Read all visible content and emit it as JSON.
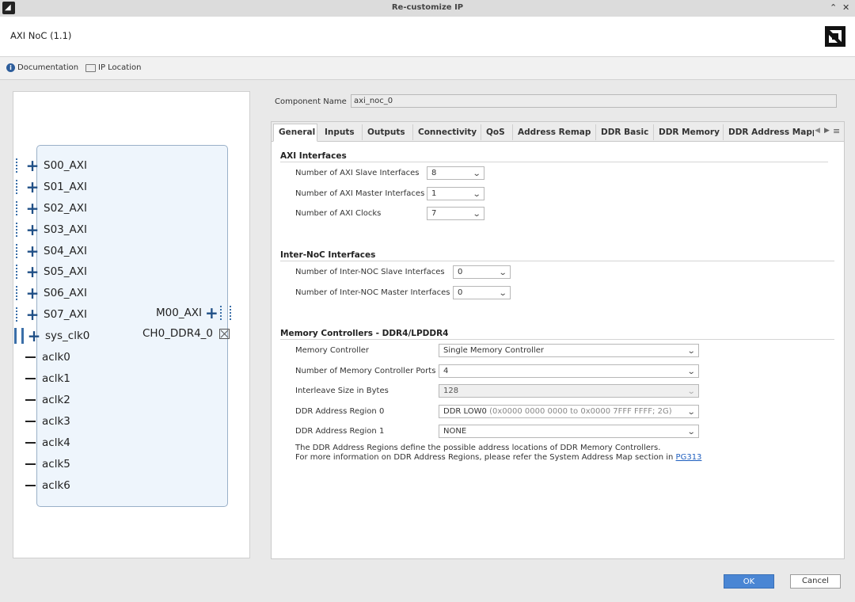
{
  "window": {
    "title": "Re-customize IP",
    "maximize_glyph": "⌃",
    "close_glyph": "✕",
    "app_icon": "amd-app-icon"
  },
  "header": {
    "ip_title": "AXI NoC (1.1)",
    "logo": "amd-logo"
  },
  "links": {
    "documentation": "Documentation",
    "ip_location": "IP Location"
  },
  "diagram": {
    "slave_ports": [
      "S00_AXI",
      "S01_AXI",
      "S02_AXI",
      "S03_AXI",
      "S04_AXI",
      "S05_AXI",
      "S06_AXI",
      "S07_AXI"
    ],
    "sys_clk": "sys_clk0",
    "clocks": [
      "aclk0",
      "aclk1",
      "aclk2",
      "aclk3",
      "aclk4",
      "aclk5",
      "aclk6"
    ],
    "master_port": "M00_AXI",
    "ddr_port": "CH0_DDR4_0"
  },
  "component": {
    "label": "Component Name",
    "value": "axi_noc_0"
  },
  "tabs": [
    "General",
    "Inputs",
    "Outputs",
    "Connectivity",
    "QoS",
    "Address Remap",
    "DDR Basic",
    "DDR Memory",
    "DDR Address Mapp"
  ],
  "active_tab": "General",
  "axi_interfaces": {
    "title": "AXI Interfaces",
    "slave_label": "Number of AXI Slave Interfaces",
    "slave_value": "8",
    "master_label": "Number of AXI Master Interfaces",
    "master_value": "1",
    "clocks_label": "Number of AXI Clocks",
    "clocks_value": "7"
  },
  "inter_noc": {
    "title": "Inter-NoC Interfaces",
    "slave_label": "Number of Inter-NOC Slave Interfaces",
    "slave_value": "0",
    "master_label": "Number of Inter-NOC Master Interfaces",
    "master_value": "0"
  },
  "memory": {
    "title": "Memory Controllers - DDR4/LPDDR4",
    "controller_label": "Memory Controller",
    "controller_value": "Single Memory Controller",
    "ports_label": "Number of Memory Controller Ports",
    "ports_value": "4",
    "interleave_label": "Interleave Size in Bytes",
    "interleave_value": "128",
    "region0_label": "DDR Address Region 0",
    "region0_value": "DDR LOW0",
    "region0_hint": "(0x0000 0000 0000 to 0x0000 7FFF FFFF; 2G)",
    "region1_label": "DDR Address Region 1",
    "region1_value": "NONE",
    "note_line1": "The DDR Address Regions define the possible address locations of DDR Memory Controllers.",
    "note_line2": "For more information on DDR Address Regions, please refer the System Address Map section in",
    "note_link": "PG313"
  },
  "buttons": {
    "ok": "OK",
    "cancel": "Cancel"
  }
}
